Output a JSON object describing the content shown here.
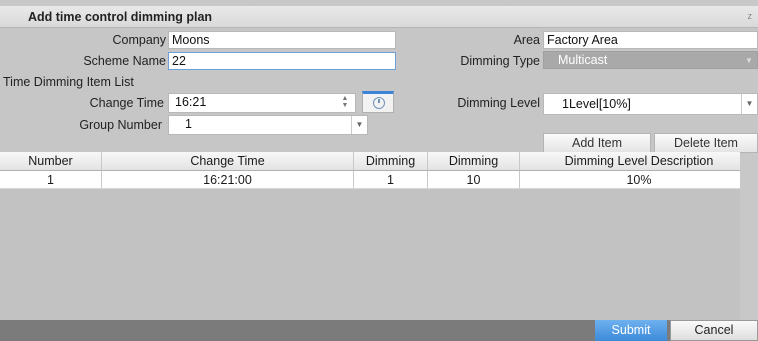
{
  "dialog": {
    "title": "Add time control dimming plan",
    "close_glyph": "z"
  },
  "form": {
    "company_label": "Company",
    "company_value": "Moons",
    "area_label": "Area",
    "area_value": "Factory Area",
    "scheme_label": "Scheme Name",
    "scheme_value": "22",
    "dimming_type_label": "Dimming Type",
    "dimming_type_value": "Multicast",
    "section_label": "Time Dimming Item List",
    "change_time_label": "Change Time",
    "change_time_value": "16:21",
    "dimming_level_label": "Dimming Level",
    "dimming_level_value": "1Level[10%]",
    "group_label": "Group Number",
    "group_value": "1",
    "add_item": "Add Item",
    "delete_item": "Delete Item"
  },
  "table": {
    "columns": [
      "Number",
      "Change Time",
      "Dimming",
      "Dimming",
      "Dimming Level Description"
    ],
    "rows": [
      [
        "1",
        "16:21:00",
        "1",
        "10",
        "10%"
      ]
    ]
  },
  "footer": {
    "submit": "Submit",
    "cancel": "Cancel"
  },
  "colors": {
    "accent": "#3c8ad9",
    "panel": "#c6c6c6",
    "footer": "#7b7b7b"
  },
  "icons": {
    "time_picker": "clock-icon",
    "dropdown": "chevron-down-icon",
    "spinner": "spinner-arrows-icon"
  }
}
